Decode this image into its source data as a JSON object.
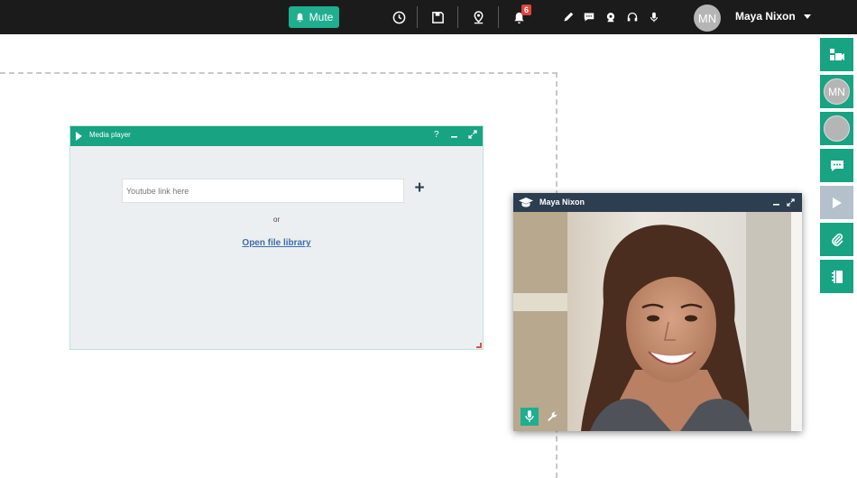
{
  "topbar": {
    "mute_label": "Mute",
    "notification_count": "6",
    "user_initials": "MN",
    "user_name": "Maya Nixon",
    "accent": "#1fae8f"
  },
  "media_player": {
    "title": "Media player",
    "help_label": "?",
    "input_placeholder": "Youtube link here",
    "add_label": "+",
    "or_text": "or",
    "library_link": "Open file library",
    "header_color": "#18a383"
  },
  "video_window": {
    "name": "Maya Nixon",
    "header_color": "#2c3e50"
  },
  "right_rail": {
    "items": [
      {
        "icon": "video-switch-icon"
      },
      {
        "icon": "avatar",
        "initials": "MN"
      },
      {
        "icon": "avatar-blank",
        "initials": ""
      },
      {
        "icon": "chat-icon"
      },
      {
        "icon": "play-icon",
        "disabled": true
      },
      {
        "icon": "attachment-icon"
      },
      {
        "icon": "notebook-icon"
      }
    ]
  }
}
